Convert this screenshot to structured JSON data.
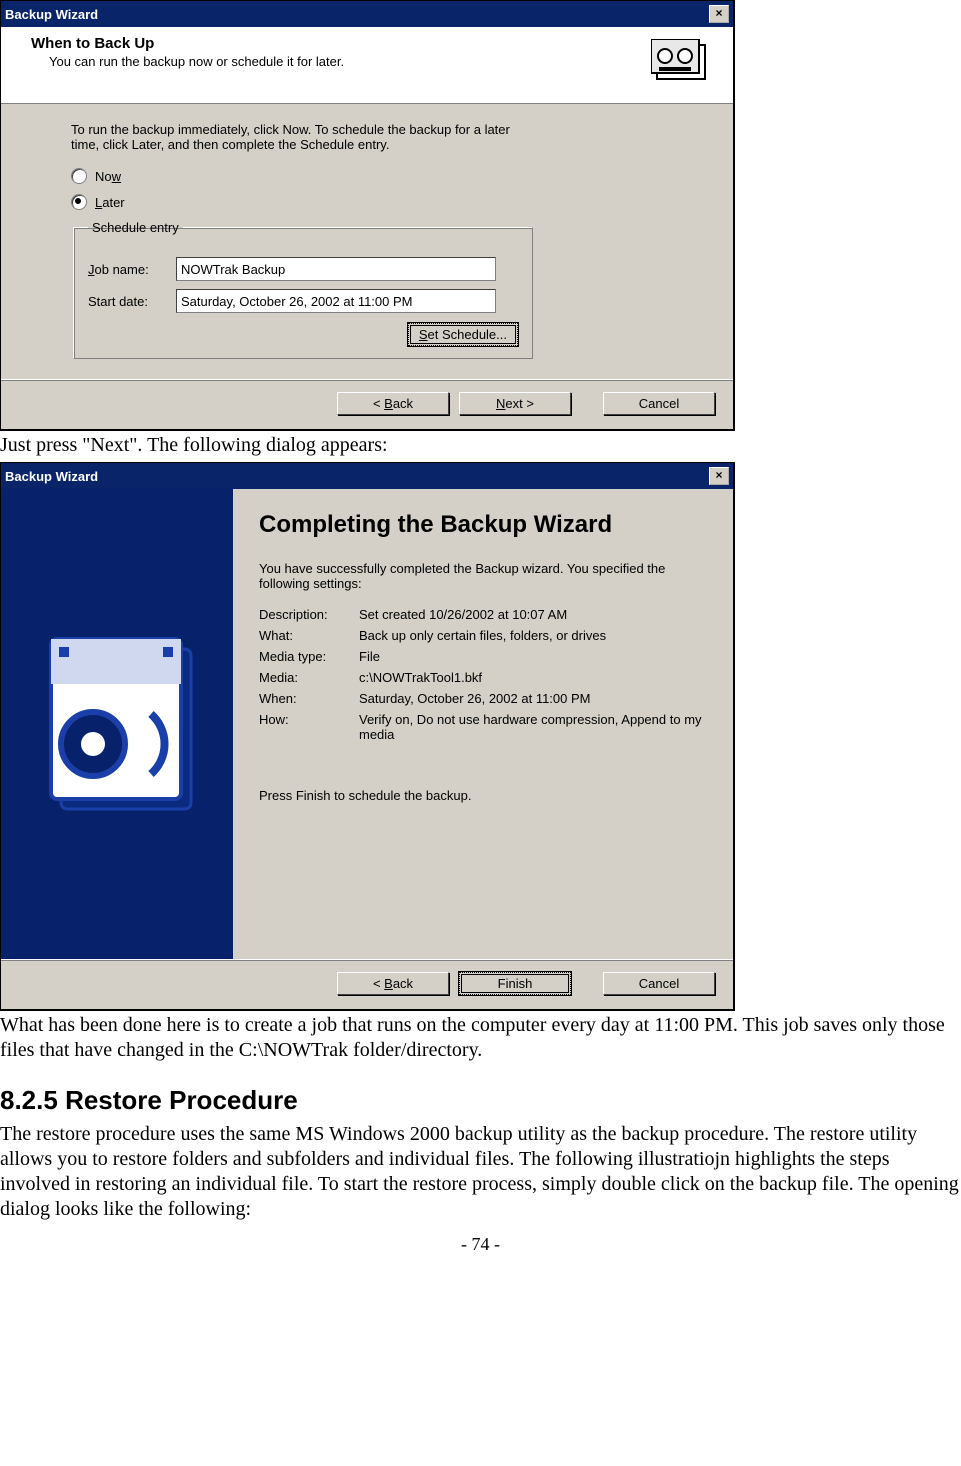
{
  "dialog1": {
    "title": "Backup Wizard",
    "close": "×",
    "headerTitle": "When to Back Up",
    "headerSub": "You can run the backup now or schedule it for later.",
    "instructions": "To run the backup immediately, click Now. To schedule the backup for a later time, click Later, and then complete the Schedule entry.",
    "radioNow": "Now",
    "radioLater": "Later",
    "scheduleLegend": "Schedule entry",
    "jobNameLabel": "Job name:",
    "jobNameValue": "NOWTrak Backup",
    "startDateLabel": "Start date:",
    "startDateValue": "Saturday, October 26, 2002 at 11:00 PM",
    "setSchedule": "Set Schedule...",
    "back": "< Back",
    "next": "Next >",
    "cancel": "Cancel"
  },
  "docText1": "Just press \"Next\".  The following dialog appears:",
  "dialog2": {
    "title": "Backup Wizard",
    "close": "×",
    "completeTitle": "Completing the Backup Wizard",
    "line1": "You have successfully completed the Backup wizard. You specified the following settings:",
    "desc": {
      "k": "Description:",
      "v": "Set created 10/26/2002 at 10:07 AM"
    },
    "what": {
      "k": "What:",
      "v": "Back up only certain files, folders, or drives"
    },
    "mediaType": {
      "k": "Media type:",
      "v": "File"
    },
    "media": {
      "k": "Media:",
      "v": "c:\\NOWTrakTool1.bkf"
    },
    "when": {
      "k": "When:",
      "v": "Saturday, October 26, 2002 at 11:00 PM"
    },
    "how": {
      "k": "How:",
      "v": "Verify on, Do not use hardware compression, Append to my media"
    },
    "press": "Press Finish to schedule the backup.",
    "back": "< Back",
    "finish": "Finish",
    "cancel": "Cancel"
  },
  "docText2": "What has been done here is to create a job that runs on the computer every day at 11:00 PM.  This job saves only those files that have changed in the C:\\NOWTrak folder/directory.",
  "sectionNum": "8.2.5",
  "sectionTitle": "Restore Procedure",
  "docText3": "The restore procedure uses the same MS Windows 2000 backup utility as the backup procedure.  The restore utility allows you to restore folders and subfolders and individual files.  The following illustratiojn highlights the steps involved in restoring an individual file.  To start the restore process, simply double click on the backup file.  The opening dialog looks like the following:",
  "pageNum": "- 74 -"
}
